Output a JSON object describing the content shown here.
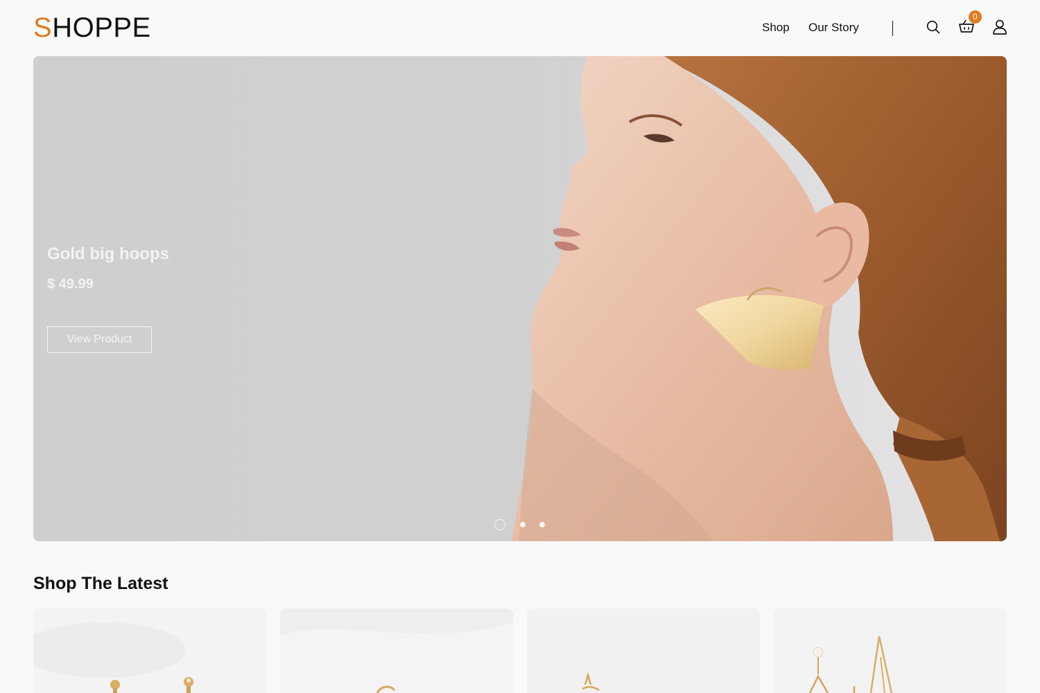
{
  "header": {
    "logo_first_letter": "S",
    "logo_rest": "HOPPE",
    "nav": [
      {
        "label": "Shop"
      },
      {
        "label": "Our Story"
      }
    ],
    "cart_count": "0",
    "icons": [
      "search-icon",
      "cart-icon",
      "user-icon"
    ]
  },
  "hero": {
    "title": "Gold big hoops",
    "price": "$ 49.99",
    "button_label": "View Product",
    "slides_total": 3,
    "active_slide": 1
  },
  "latest": {
    "title": "Shop The Latest",
    "products_visible": 4
  },
  "colors": {
    "accent": "#e07b1f",
    "background": "#f8f9fb",
    "text": "#111111"
  }
}
